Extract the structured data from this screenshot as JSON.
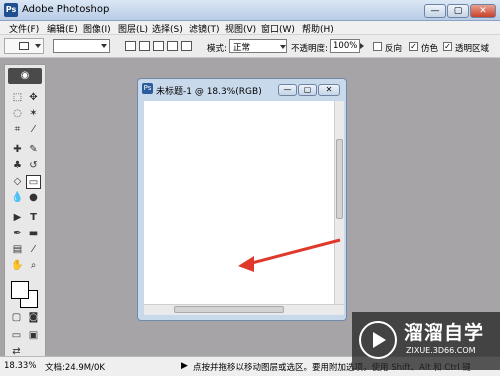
{
  "window": {
    "title": "Adobe Photoshop",
    "app_icon": "Ps",
    "min": "—",
    "max": "▢",
    "close": "✕"
  },
  "menu": [
    "文件(F)",
    "编辑(E)",
    "图像(I)",
    "图层(L)",
    "选择(S)",
    "滤镜(T)",
    "视图(V)",
    "窗口(W)",
    "帮助(H)"
  ],
  "options": {
    "mode_label": "模式:",
    "mode_value": "正常",
    "opacity_label": "不透明度:",
    "opacity_value": "100%",
    "reverse_label": "反向",
    "dither_label": "仿色",
    "transparency_label": "透明区域",
    "dither_checked": "✓",
    "transparency_checked": "✓"
  },
  "document": {
    "title": "未标题-1 @ 18.3%(RGB)",
    "min": "—",
    "max": "▢",
    "close": "✕"
  },
  "status": {
    "zoom": "18.33%",
    "doc_size": "文档:24.9M/0K",
    "hint": "点按并拖移以移动图层或选区。要用附加选项，使用 Shift、Alt 和 Ctrl 键"
  },
  "watermark": {
    "brand": "溜溜自学",
    "url": "ZIXUE.3D66.COM"
  },
  "colors": {
    "arrow": "#e0392b"
  }
}
